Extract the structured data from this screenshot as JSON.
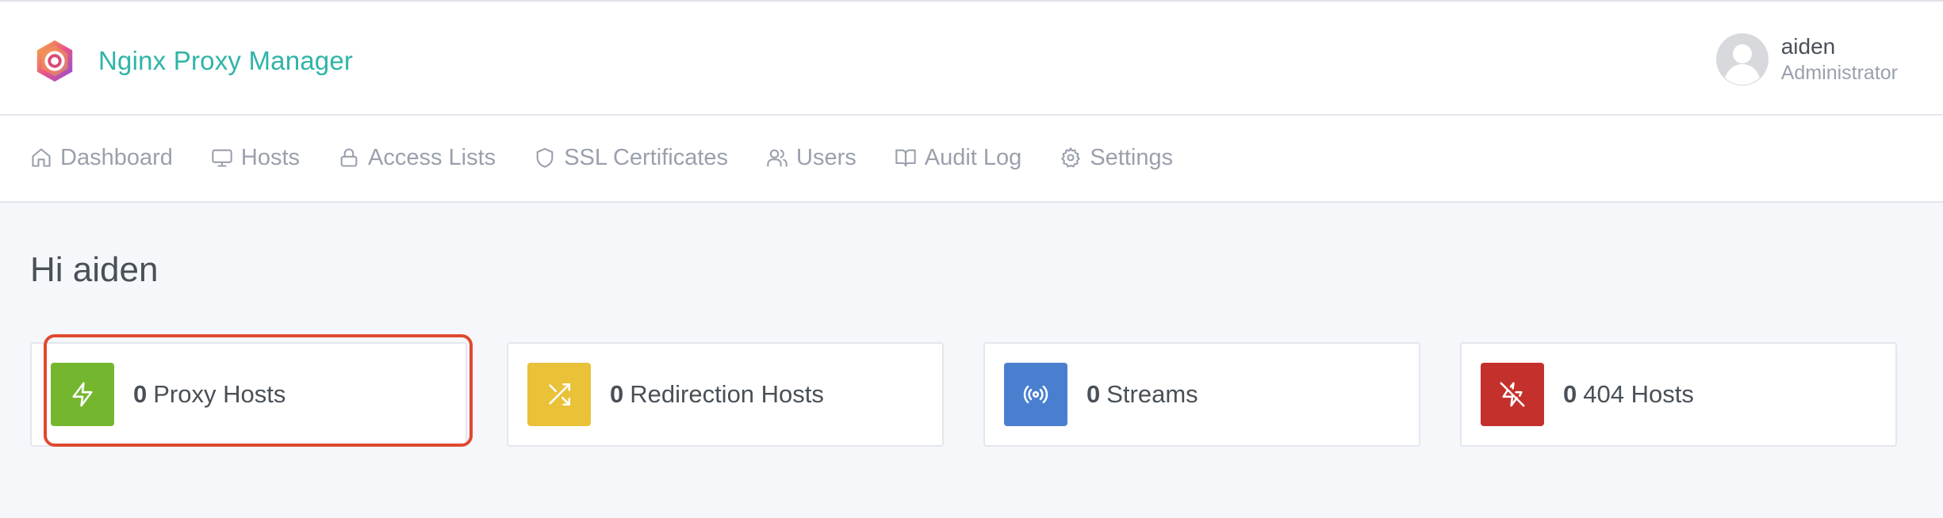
{
  "app": {
    "title": "Nginx Proxy Manager"
  },
  "user": {
    "name": "aiden",
    "role": "Administrator"
  },
  "nav": {
    "items": [
      {
        "label": "Dashboard",
        "icon": "home-icon"
      },
      {
        "label": "Hosts",
        "icon": "monitor-icon"
      },
      {
        "label": "Access Lists",
        "icon": "lock-icon"
      },
      {
        "label": "SSL Certificates",
        "icon": "shield-icon"
      },
      {
        "label": "Users",
        "icon": "users-icon"
      },
      {
        "label": "Audit Log",
        "icon": "book-icon"
      },
      {
        "label": "Settings",
        "icon": "gear-icon"
      }
    ]
  },
  "page": {
    "greeting": "Hi aiden"
  },
  "stats": [
    {
      "count": "0",
      "label": "Proxy Hosts",
      "icon": "zap-icon",
      "color": "#74b72e",
      "highlighted": true
    },
    {
      "count": "0",
      "label": "Redirection Hosts",
      "icon": "shuffle-icon",
      "color": "#e9c23a",
      "highlighted": false
    },
    {
      "count": "0",
      "label": "Streams",
      "icon": "radio-icon",
      "color": "#4a7fd0",
      "highlighted": false
    },
    {
      "count": "0",
      "label": "404 Hosts",
      "icon": "zap-off-icon",
      "color": "#c4302b",
      "highlighted": false
    }
  ],
  "colors": {
    "brand": "#2fb4a8",
    "highlight": "#e0492f"
  }
}
